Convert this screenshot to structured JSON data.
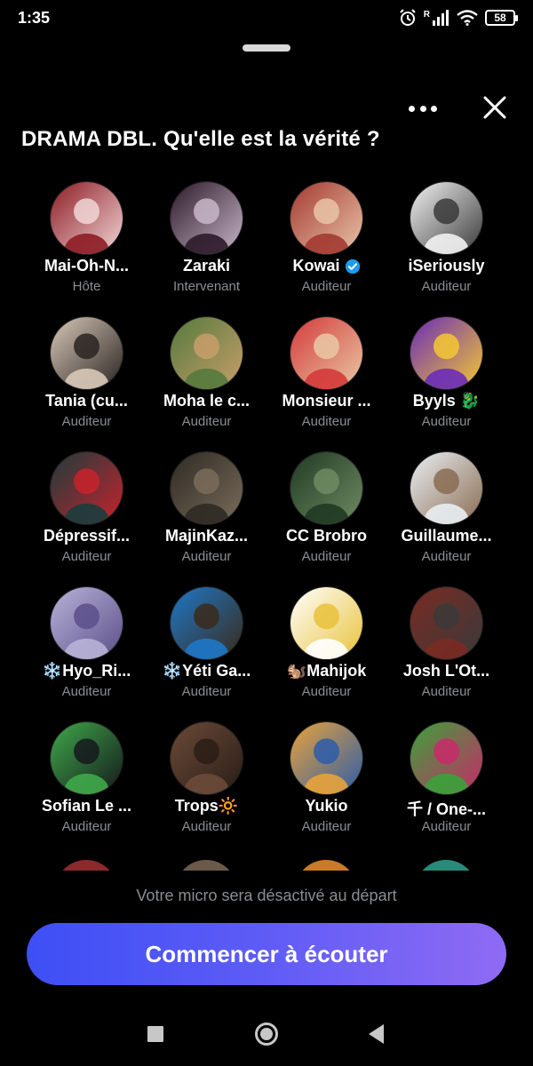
{
  "status_bar": {
    "time": "1:35",
    "battery": "58",
    "signal_badge": "R"
  },
  "space": {
    "title": "DRAMA DBL. Qu'elle est la vérité ?"
  },
  "participants": [
    {
      "name": "Mai-Oh-N...",
      "role": "Hôte",
      "colors": [
        "#8d1c25",
        "#f1d6d6"
      ]
    },
    {
      "name": "Zaraki",
      "role": "Intervenant",
      "colors": [
        "#2c1a29",
        "#c8b7c9"
      ]
    },
    {
      "name": "Kowai",
      "role": "Auditeur",
      "verified": true,
      "colors": [
        "#a33a31",
        "#e9c4a8"
      ]
    },
    {
      "name": "iSeriously",
      "role": "Auditeur",
      "colors": [
        "#f2f2f2",
        "#3a3a3a"
      ]
    },
    {
      "name": "Tania (cu...",
      "role": "Auditeur",
      "colors": [
        "#d8c9b8",
        "#2a2321"
      ]
    },
    {
      "name": "Moha le c...",
      "role": "Auditeur",
      "colors": [
        "#547a3d",
        "#c89e6a"
      ]
    },
    {
      "name": "Monsieur ...",
      "role": "Auditeur",
      "colors": [
        "#d43a3a",
        "#e9c8a4"
      ]
    },
    {
      "name": "Byyls 🐉",
      "role": "Auditeur",
      "colors": [
        "#6a2cb8",
        "#f4c832"
      ]
    },
    {
      "name": "Dépressif...",
      "role": "Auditeur",
      "colors": [
        "#1a3d3d",
        "#c9222b"
      ]
    },
    {
      "name": "MajinKaz...",
      "role": "Auditeur",
      "colors": [
        "#2e2a24",
        "#7a6c5a"
      ]
    },
    {
      "name": "CC Brobro",
      "role": "Auditeur",
      "colors": [
        "#1f3a22",
        "#6f8b63"
      ]
    },
    {
      "name": "Guillaume...",
      "role": "Auditeur",
      "colors": [
        "#e9eef2",
        "#8a6c52"
      ]
    },
    {
      "name": "❄️Hyo_Ri...",
      "role": "Auditeur",
      "colors": [
        "#b8b3d8",
        "#5b4f8a"
      ]
    },
    {
      "name": "❄️Yéti Ga...",
      "role": "Auditeur",
      "colors": [
        "#1e78c8",
        "#3a2a1a"
      ]
    },
    {
      "name": "🐿️Mahijok",
      "role": "Auditeur",
      "colors": [
        "#ffffff",
        "#e8c23a"
      ]
    },
    {
      "name": "Josh L'Ot...",
      "role": "Auditeur",
      "colors": [
        "#7a2a22",
        "#3a3a3a"
      ]
    },
    {
      "name": "Sofian Le ...",
      "role": "Auditeur",
      "colors": [
        "#3fa84a",
        "#15191d"
      ]
    },
    {
      "name": "Trops🔆",
      "role": "Auditeur",
      "colors": [
        "#6b4a38",
        "#2a1d16"
      ]
    },
    {
      "name": "Yukio",
      "role": "Auditeur",
      "colors": [
        "#e8a33a",
        "#2d5ca8"
      ]
    },
    {
      "name": "千 / One-...",
      "role": "Auditeur",
      "colors": [
        "#3aa23a",
        "#c82a6a"
      ]
    }
  ],
  "footer": {
    "mic_note": "Votre micro sera désactivé au départ",
    "listen_button": "Commencer à écouter"
  },
  "icons": {
    "more": "more-dots-icon",
    "close": "close-icon",
    "verified": "verified-badge-icon"
  },
  "accent": {
    "button_start": "#3d4ff5",
    "button_end": "#8f6bf4",
    "verified": "#1d9bf0"
  }
}
